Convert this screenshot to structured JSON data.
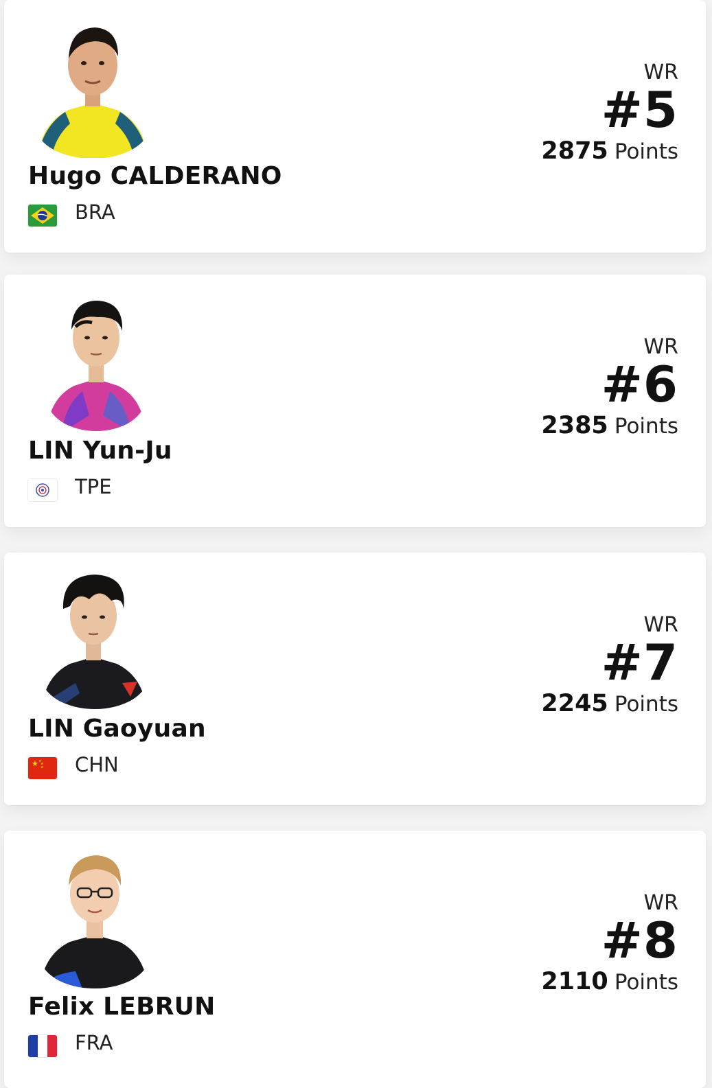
{
  "rank_prefix_label": "WR",
  "points_unit": "Points",
  "players": [
    {
      "name": "Hugo CALDERANO",
      "country": "BRA",
      "rank": "#5",
      "points": "2875",
      "flag_icon": "flag-brazil-icon",
      "jersey_color": "#f2e521"
    },
    {
      "name": "LIN Yun-Ju",
      "country": "TPE",
      "rank": "#6",
      "points": "2385",
      "flag_icon": "flag-chinese-taipei-icon",
      "jersey_color": "#d23c9c"
    },
    {
      "name": "LIN Gaoyuan",
      "country": "CHN",
      "rank": "#7",
      "points": "2245",
      "flag_icon": "flag-china-icon",
      "jersey_color": "#1b1b1f"
    },
    {
      "name": "Felix LEBRUN",
      "country": "FRA",
      "rank": "#8",
      "points": "2110",
      "flag_icon": "flag-france-icon",
      "jersey_color": "#1a1a1c"
    }
  ]
}
